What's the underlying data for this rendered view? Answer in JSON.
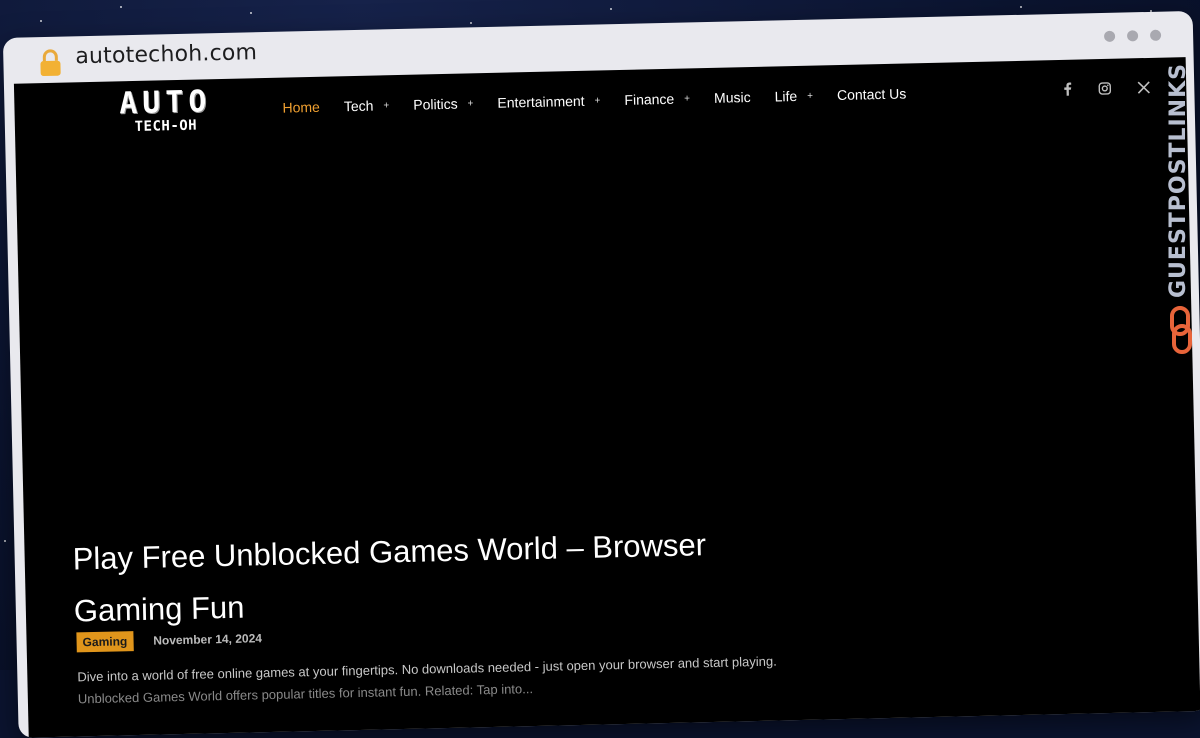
{
  "browser": {
    "url": "autotechoh.com"
  },
  "site": {
    "logo_top": "AUTO",
    "logo_bottom": "TECH-OH"
  },
  "nav": {
    "items": [
      {
        "label": "Home",
        "active": true,
        "has_submenu": false
      },
      {
        "label": "Tech",
        "active": false,
        "has_submenu": true
      },
      {
        "label": "Politics",
        "active": false,
        "has_submenu": true
      },
      {
        "label": "Entertainment",
        "active": false,
        "has_submenu": true
      },
      {
        "label": "Finance",
        "active": false,
        "has_submenu": true
      },
      {
        "label": "Music",
        "active": false,
        "has_submenu": false
      },
      {
        "label": "Life",
        "active": false,
        "has_submenu": true
      },
      {
        "label": "Contact Us",
        "active": false,
        "has_submenu": false
      }
    ],
    "submenu_marker": "+"
  },
  "social": {
    "icons": [
      "facebook-icon",
      "instagram-icon",
      "x-twitter-icon"
    ]
  },
  "hero": {
    "title": "Play Free Unblocked Games World – Browser Gaming Fun",
    "category": "Gaming",
    "date": "November 14, 2024",
    "excerpt_line1": "Dive into a world of free online games at your fingertips. No downloads needed - just open your browser and start playing.",
    "excerpt_line2": "Unblocked Games World offers popular titles for instant fun. Related: Tap into..."
  },
  "watermark": {
    "text": "GUESTPOSTLINKS"
  },
  "colors": {
    "accent": "#f0a030",
    "badge": "#e0951b",
    "page_background": "#000000",
    "browser_chrome": "#e9e9ee",
    "watermark_icon": "#e8643a"
  }
}
